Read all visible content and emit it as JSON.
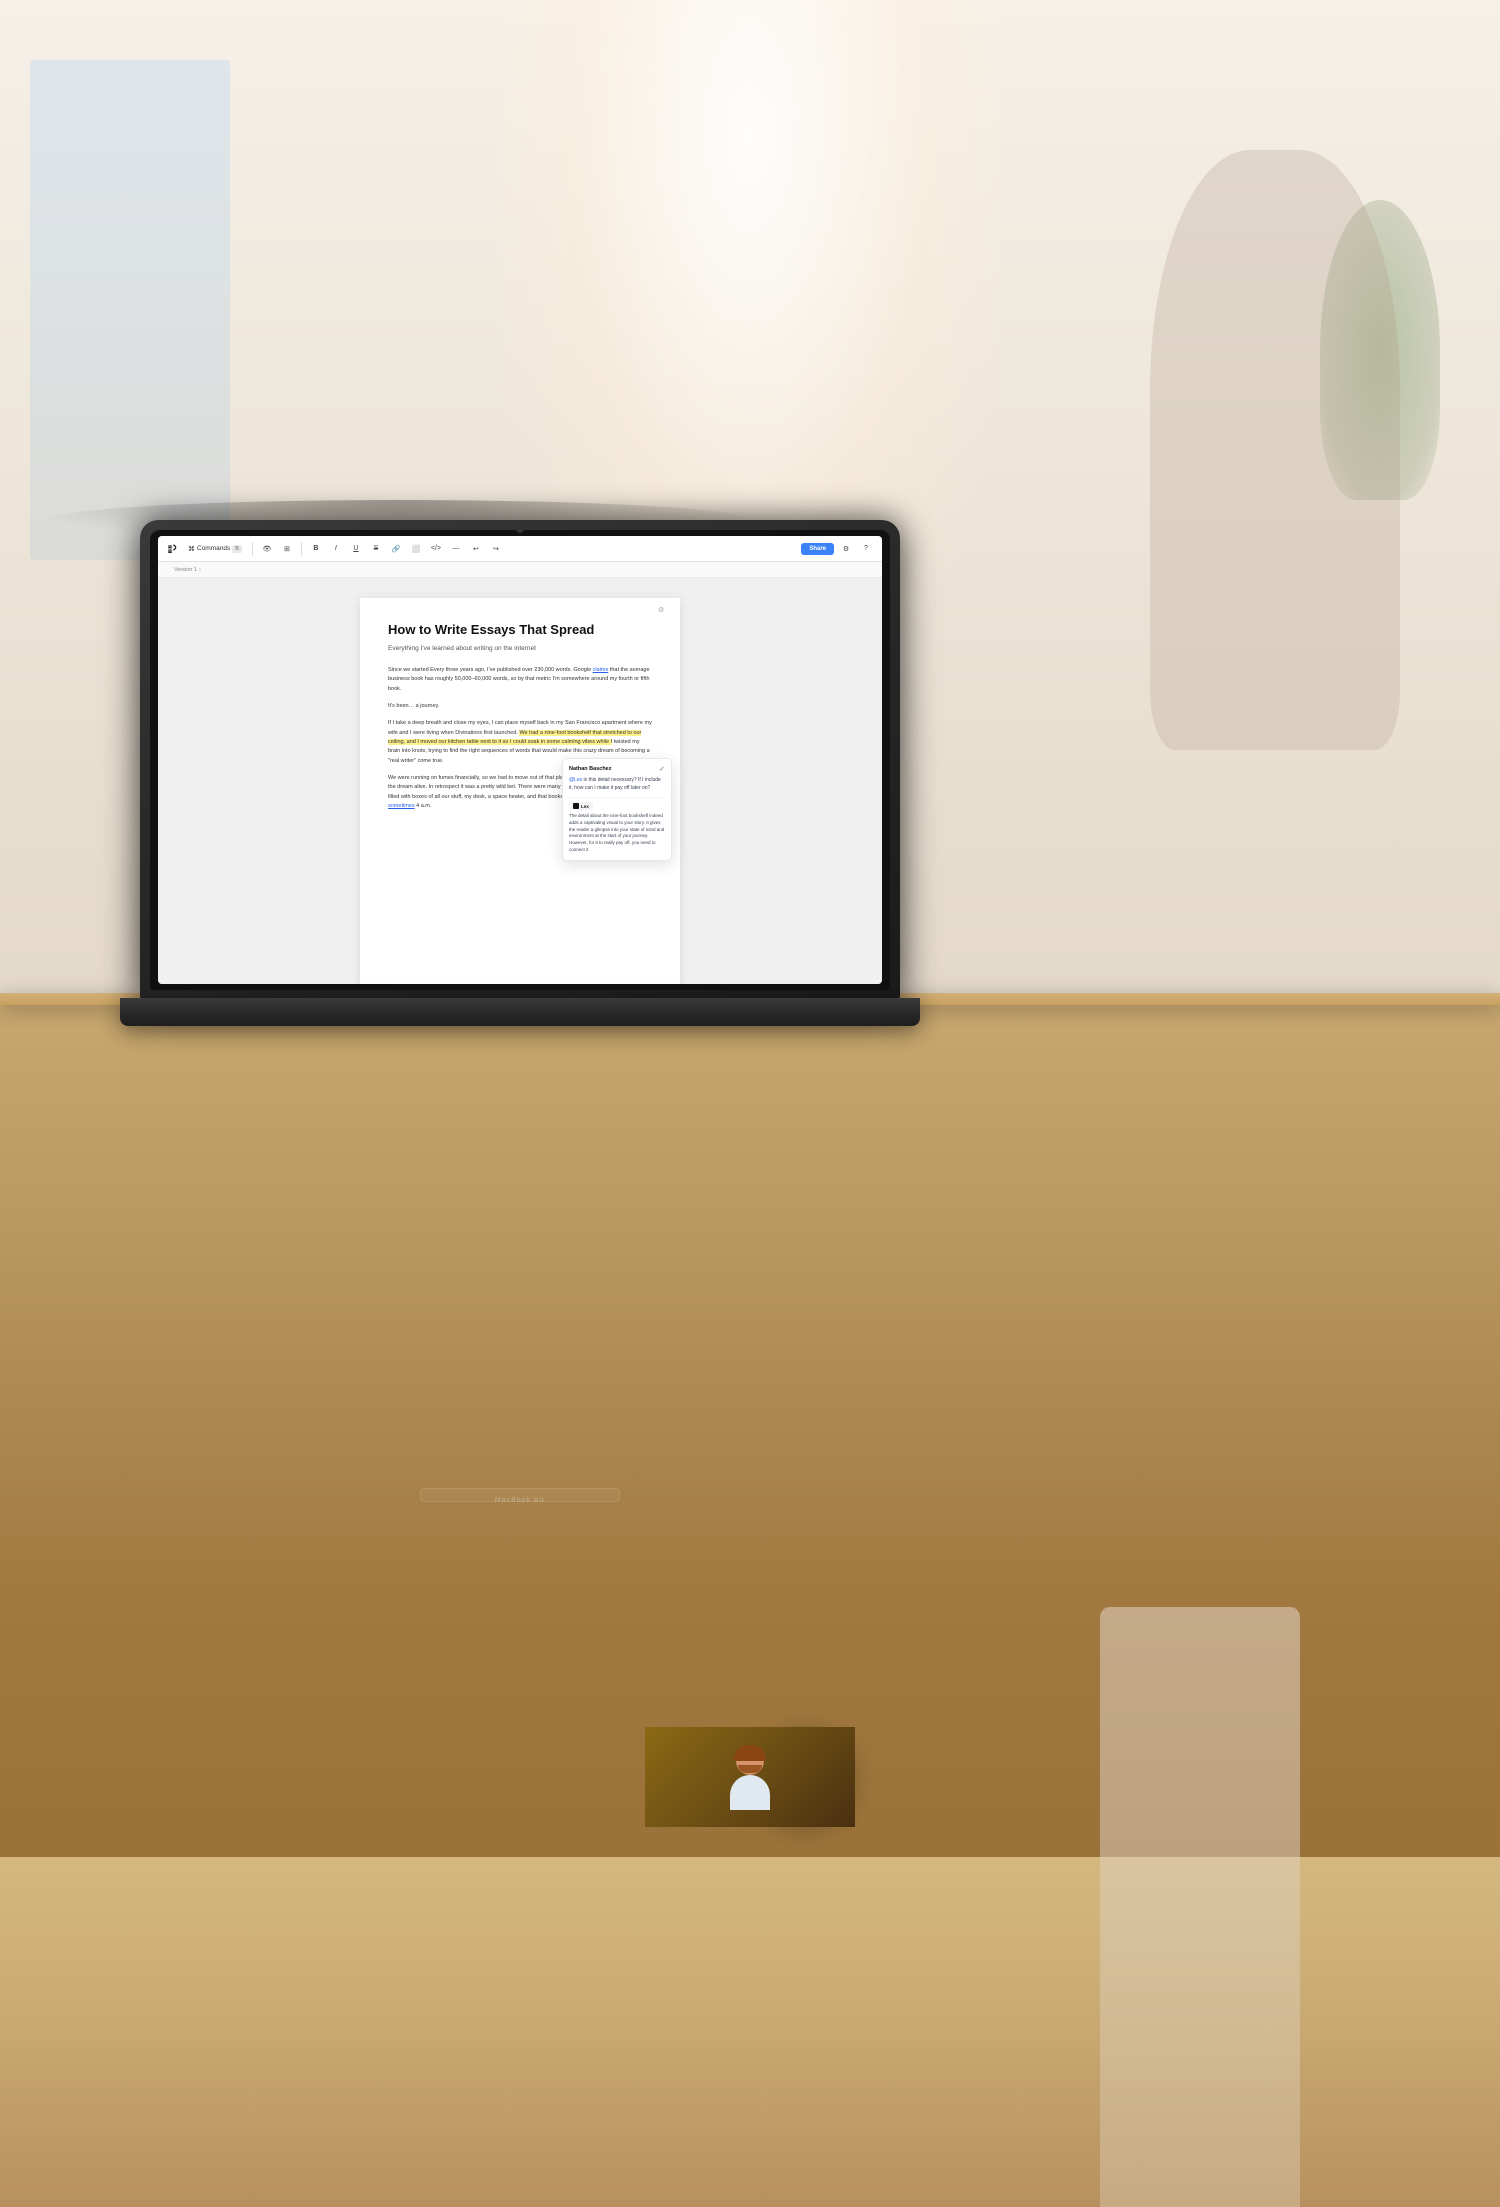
{
  "app": {
    "title": "Lex",
    "toolbar": {
      "logo_alt": "lex-logo",
      "commands_label": "Commands",
      "commands_shortcut": "⌘B",
      "share_label": "Share",
      "version_label": "Version 1",
      "icons": [
        "eye",
        "layout",
        "bold",
        "italic",
        "underline",
        "strikethrough",
        "link",
        "image",
        "code",
        "dash",
        "undo",
        "redo",
        "settings"
      ],
      "settings_icon": "⚙",
      "help_icon": "?"
    },
    "document": {
      "title": "How to Write Essays That Spread",
      "subtitle": "Everything I've learned about writing on the internet",
      "paragraphs": [
        "Since we started Every three years ago, I've published over 230,000 words. Google claims that the average business book has roughly 50,000–60,000 words, so by that metric I'm somewhere around my fourth or fifth book.",
        "It's been… a journey.",
        "If I take a deep breath and close my eyes, I can place myself back in my San Francisco apartment where my wife and I were living when Divinations first launched. We had a nine-foot bookshelf that stretched to our ceiling, and I moved our kitchen table next to it so I could soak in some calming vibes while I twisted my brain into knots, trying to find the right sequences of words that would make this crazy dream of becoming a \"real writer\" come true.",
        "We were running on fumes financially, so we had to move out of that place and in with my in-laws to keep the dream alive. In retrospect it was a pretty wild bet. There were many late nights in my office—a garage filled with boxes of all our stuff, my desk, a space heater, and that bookshelf—that lasted until 2, 3, even sometimes 4 a.m."
      ],
      "link_text": "claims",
      "sometimes_underline": "sometimes",
      "highlight_text": "We had a nine-foot bookshelf that stretched to our ceiling, and I moved our kitchen table next to it so I could soak in some calming vibes while I"
    },
    "comment": {
      "user": "Nathan Baschez",
      "check": "✓",
      "text": "@Lex is this detail necessary? If I include it, how can I make it pay off later on?",
      "mention": "@Lex",
      "ai_name": "Lex",
      "ai_response": "The detail about the nine-foot bookshelf indeed adds a captivating visual to your story. It gives the reader a glimpse into your state of mind and environment at the start of your journey. However, for it to really pay off, you need to connect it"
    }
  },
  "logo": {
    "lex_mark": "LEX",
    "bars": 3
  },
  "author": {
    "has_avatar": true,
    "alt": "Author headshot"
  },
  "laptop": {
    "model": "MacBook Air"
  }
}
